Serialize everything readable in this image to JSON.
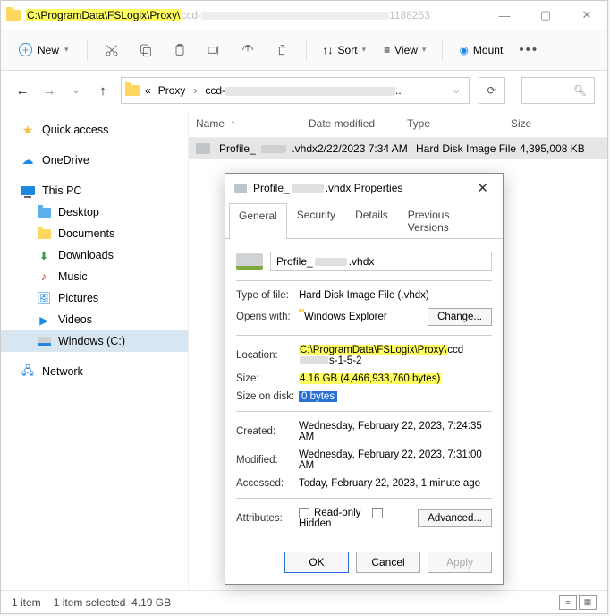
{
  "title": {
    "path_highlight": "C:\\ProgramData\\FSLogix\\Proxy\\",
    "path_gray_prefix": "ccd-",
    "path_gray_suffix": "1188253"
  },
  "toolbar": {
    "new_label": "New",
    "sort_label": "Sort",
    "view_label": "View",
    "mount_label": "Mount"
  },
  "breadcrumb": {
    "sep1": "«",
    "crumb1": "Proxy",
    "crumb2_prefix": "ccd-"
  },
  "sidebar": {
    "quick": "Quick access",
    "onedrive": "OneDrive",
    "thispc": "This PC",
    "desktop": "Desktop",
    "documents": "Documents",
    "downloads": "Downloads",
    "music": "Music",
    "pictures": "Pictures",
    "videos": "Videos",
    "cdrive": "Windows (C:)",
    "network": "Network"
  },
  "columns": {
    "name": "Name",
    "date": "Date modified",
    "type": "Type",
    "size": "Size"
  },
  "row": {
    "name_prefix": "Profile_",
    "name_suffix": ".vhdx",
    "date": "2/22/2023 7:34 AM",
    "type": "Hard Disk Image File",
    "size": "4,395,008 KB"
  },
  "dialog": {
    "title_prefix": "Profile_",
    "title_suffix": ".vhdx Properties",
    "tabs": {
      "general": "General",
      "security": "Security",
      "details": "Details",
      "prev": "Previous Versions"
    },
    "fname_prefix": "Profile_",
    "fname_suffix": ".vhdx",
    "type_k": "Type of file:",
    "type_v": "Hard Disk Image File (.vhdx)",
    "opens_k": "Opens with:",
    "opens_v": "Windows Explorer",
    "change": "Change...",
    "loc_k": "Location:",
    "loc_hl": "C:\\ProgramData\\FSLogix\\Proxy\\",
    "loc_after1": "ccd",
    "loc_after2": "s-1-5-2",
    "size_k": "Size:",
    "size_v": "4.16 GB (4,466,933,760 bytes)",
    "sod_k": "Size on disk:",
    "sod_v": "0 bytes",
    "created_k": "Created:",
    "created_v": "Wednesday, February 22, 2023, 7:24:35 AM",
    "modified_k": "Modified:",
    "modified_v": "Wednesday, February 22, 2023, 7:31:00 AM",
    "accessed_k": "Accessed:",
    "accessed_v": "Today, February 22, 2023, 1 minute ago",
    "attr_k": "Attributes:",
    "readonly": "Read-only",
    "hidden": "Hidden",
    "advanced": "Advanced...",
    "ok": "OK",
    "cancel": "Cancel",
    "apply": "Apply"
  },
  "status": {
    "count": "1 item",
    "selected": "1 item selected",
    "selsize": "4.19 GB"
  }
}
